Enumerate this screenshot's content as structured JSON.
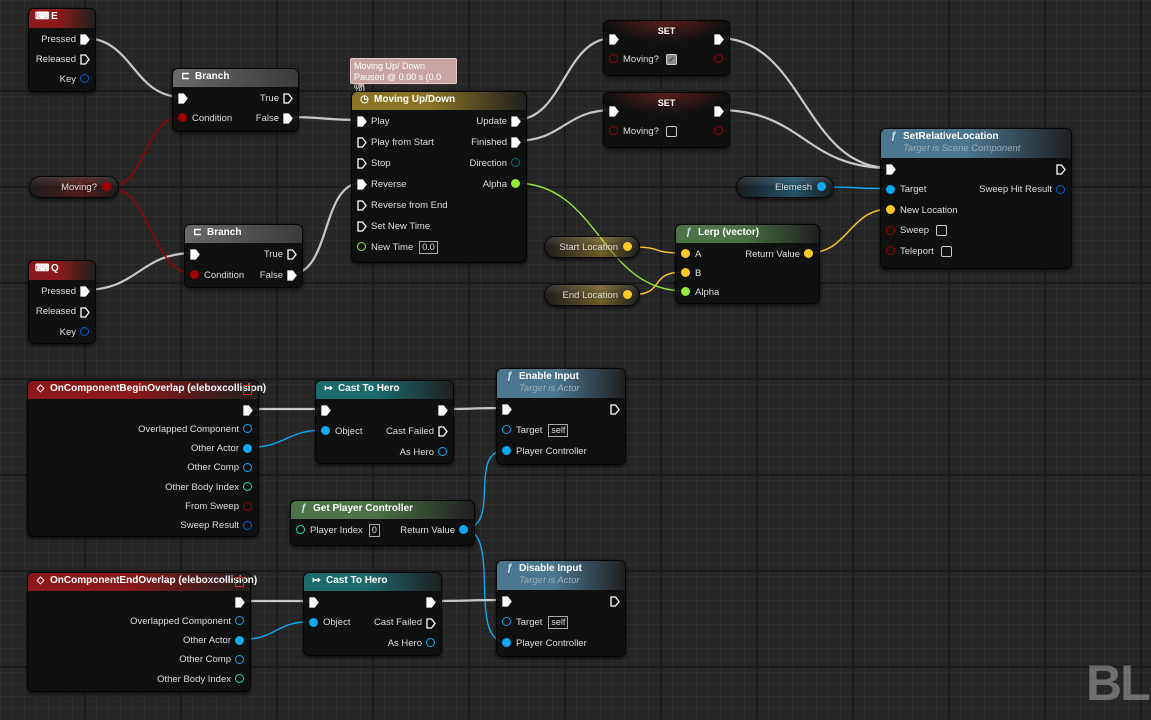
{
  "tooltip": {
    "line1": "Moving Up/ Down",
    "line2": "Paused @ 0.00 s (0.0 %)"
  },
  "watermark": "BL",
  "pin_colors": {
    "exec": "#ffffff",
    "bool": "#a00000",
    "object": "#10a8f0",
    "struct": "#0060d8",
    "vector": "#fdc82a",
    "float": "#96e83c",
    "int": "#22e0a8",
    "byte": "#007070"
  },
  "header_colors": {
    "input": "#8c1a1a",
    "branch": "#5c5c5c",
    "timeline": "#8a7424",
    "set": "#5a1c1c",
    "function": "#4a7690",
    "pure": "#4c7446",
    "cast": "#1c6a6c",
    "event": "#8a1818"
  },
  "graph": {
    "nodes": [
      {
        "id": "E",
        "kind": "input",
        "title": "E",
        "icon": "keyboard-icon",
        "inputs": [],
        "outputs": [
          {
            "type": "exec",
            "label": "Pressed",
            "linked": true
          },
          {
            "type": "exec",
            "label": "Released"
          },
          {
            "type": "struct",
            "label": "Key"
          }
        ]
      },
      {
        "id": "branch1",
        "kind": "branch",
        "title": "Branch",
        "icon": "branch-icon",
        "inputs": [
          {
            "type": "exec",
            "label": "",
            "linked": true
          },
          {
            "type": "bool",
            "label": "Condition",
            "linked": true
          }
        ],
        "outputs": [
          {
            "type": "exec",
            "label": "True"
          },
          {
            "type": "exec",
            "label": "False",
            "linked": true
          }
        ]
      },
      {
        "id": "moving",
        "kind": "variable",
        "title": "Moving?",
        "color": "bool",
        "outputs": [
          {
            "type": "bool",
            "linked": true
          }
        ]
      },
      {
        "id": "branch2",
        "kind": "branch",
        "title": "Branch",
        "icon": "branch-icon",
        "inputs": [
          {
            "type": "exec",
            "label": "",
            "linked": true
          },
          {
            "type": "bool",
            "label": "Condition",
            "linked": true
          }
        ],
        "outputs": [
          {
            "type": "exec",
            "label": "True"
          },
          {
            "type": "exec",
            "label": "False",
            "linked": true
          }
        ]
      },
      {
        "id": "Q",
        "kind": "input",
        "title": "Q",
        "icon": "keyboard-icon",
        "inputs": [],
        "outputs": [
          {
            "type": "exec",
            "label": "Pressed",
            "linked": true
          },
          {
            "type": "exec",
            "label": "Released"
          },
          {
            "type": "struct",
            "label": "Key"
          }
        ]
      },
      {
        "id": "timeline",
        "kind": "timeline",
        "title": "Moving Up/Down",
        "icon": "clock-icon",
        "inputs": [
          {
            "type": "exec",
            "label": "Play",
            "linked": true
          },
          {
            "type": "exec",
            "label": "Play from Start"
          },
          {
            "type": "exec",
            "label": "Stop"
          },
          {
            "type": "exec",
            "label": "Reverse",
            "linked": true
          },
          {
            "type": "exec",
            "label": "Reverse from End"
          },
          {
            "type": "exec",
            "label": "Set New Time"
          },
          {
            "type": "float",
            "label": "New Time",
            "value": "0.0"
          }
        ],
        "outputs": [
          {
            "type": "exec",
            "label": "Update",
            "linked": true
          },
          {
            "type": "exec",
            "label": "Finished",
            "linked": true
          },
          {
            "type": "byte",
            "label": "Direction"
          },
          {
            "type": "float",
            "label": "Alpha",
            "linked": true
          }
        ]
      },
      {
        "id": "set1",
        "kind": "set",
        "title": "SET",
        "inputs": [
          {
            "type": "exec",
            "label": "",
            "linked": true
          },
          {
            "type": "bool",
            "label": "Moving?",
            "checkbox": true
          }
        ],
        "outputs": [
          {
            "type": "exec",
            "label": "",
            "linked": true
          },
          {
            "type": "bool",
            "label": ""
          }
        ]
      },
      {
        "id": "set2",
        "kind": "set",
        "title": "SET",
        "inputs": [
          {
            "type": "exec",
            "label": "",
            "linked": true
          },
          {
            "type": "bool",
            "label": "Moving?",
            "checkbox": false
          }
        ],
        "outputs": [
          {
            "type": "exec",
            "label": "",
            "linked": true
          },
          {
            "type": "bool",
            "label": ""
          }
        ]
      },
      {
        "id": "setrel",
        "kind": "function",
        "title": "SetRelativeLocation",
        "subtitle": "Target is Scene Component",
        "icon": "function-icon",
        "inputs": [
          {
            "type": "exec",
            "label": "",
            "linked": true
          },
          {
            "type": "object",
            "label": "Target",
            "linked": true
          },
          {
            "type": "vector",
            "label": "New Location",
            "linked": true
          },
          {
            "type": "bool",
            "label": "Sweep",
            "checkbox": false
          },
          {
            "type": "bool",
            "label": "Teleport",
            "checkbox": false
          }
        ],
        "outputs": [
          {
            "type": "exec",
            "label": ""
          },
          {
            "type": "struct",
            "label": "Sweep Hit Result"
          }
        ]
      },
      {
        "id": "elemesh",
        "kind": "variable",
        "title": "Elemesh",
        "color": "object",
        "outputs": [
          {
            "type": "object",
            "linked": true
          }
        ]
      },
      {
        "id": "start",
        "kind": "variable",
        "title": "Start Location",
        "color": "vector",
        "outputs": [
          {
            "type": "vector",
            "linked": true
          }
        ]
      },
      {
        "id": "end",
        "kind": "variable",
        "title": "End Location",
        "color": "vector",
        "outputs": [
          {
            "type": "vector",
            "linked": true
          }
        ]
      },
      {
        "id": "lerp",
        "kind": "pure",
        "title": "Lerp (vector)",
        "icon": "function-icon",
        "inputs": [
          {
            "type": "vector",
            "label": "A",
            "linked": true
          },
          {
            "type": "vector",
            "label": "B",
            "linked": true
          },
          {
            "type": "float",
            "label": "Alpha",
            "linked": true
          }
        ],
        "outputs": [
          {
            "type": "vector",
            "label": "Return Value",
            "linked": true
          }
        ]
      },
      {
        "id": "begin",
        "kind": "event",
        "title": "OnComponentBeginOverlap (eleboxcollision)",
        "icon": "event-icon",
        "inputs": [],
        "outputs": [
          {
            "type": "exec",
            "label": "",
            "linked": true
          },
          {
            "type": "object",
            "label": "Overlapped Component"
          },
          {
            "type": "object",
            "label": "Other Actor",
            "linked": true
          },
          {
            "type": "object",
            "label": "Other Comp"
          },
          {
            "type": "int",
            "label": "Other Body Index"
          },
          {
            "type": "bool",
            "label": "From Sweep"
          },
          {
            "type": "struct",
            "label": "Sweep Result"
          }
        ]
      },
      {
        "id": "cast1",
        "kind": "cast",
        "title": "Cast To Hero",
        "icon": "cast-icon",
        "inputs": [
          {
            "type": "exec",
            "label": "",
            "linked": true
          },
          {
            "type": "object",
            "label": "Object",
            "linked": true
          }
        ],
        "outputs": [
          {
            "type": "exec",
            "label": "",
            "linked": true
          },
          {
            "type": "exec",
            "label": "Cast Failed"
          },
          {
            "type": "object",
            "label": "As Hero"
          }
        ]
      },
      {
        "id": "enable",
        "kind": "function",
        "title": "Enable Input",
        "subtitle": "Target is Actor",
        "icon": "function-icon",
        "inputs": [
          {
            "type": "exec",
            "label": "",
            "linked": true
          },
          {
            "type": "object",
            "label": "Target",
            "value": "self"
          },
          {
            "type": "object",
            "label": "Player Controller",
            "linked": true
          }
        ],
        "outputs": [
          {
            "type": "exec",
            "label": ""
          }
        ]
      },
      {
        "id": "gpc",
        "kind": "pure",
        "title": "Get Player Controller",
        "icon": "function-icon",
        "inputs": [
          {
            "type": "int",
            "label": "Player Index",
            "value": "0"
          }
        ],
        "outputs": [
          {
            "type": "object",
            "label": "Return Value",
            "linked": true
          }
        ]
      },
      {
        "id": "endov",
        "kind": "event",
        "title": "OnComponentEndOverlap (eleboxcollision)",
        "icon": "event-icon",
        "inputs": [],
        "outputs": [
          {
            "type": "exec",
            "label": "",
            "linked": true
          },
          {
            "type": "object",
            "label": "Overlapped Component"
          },
          {
            "type": "object",
            "label": "Other Actor",
            "linked": true
          },
          {
            "type": "object",
            "label": "Other Comp"
          },
          {
            "type": "int",
            "label": "Other Body Index"
          }
        ]
      },
      {
        "id": "cast2",
        "kind": "cast",
        "title": "Cast To Hero",
        "icon": "cast-icon",
        "inputs": [
          {
            "type": "exec",
            "label": "",
            "linked": true
          },
          {
            "type": "object",
            "label": "Object",
            "linked": true
          }
        ],
        "outputs": [
          {
            "type": "exec",
            "label": "",
            "linked": true
          },
          {
            "type": "exec",
            "label": "Cast Failed"
          },
          {
            "type": "object",
            "label": "As Hero"
          }
        ]
      },
      {
        "id": "disable",
        "kind": "function",
        "title": "Disable Input",
        "subtitle": "Target is Actor",
        "icon": "function-icon",
        "inputs": [
          {
            "type": "exec",
            "label": "",
            "linked": true
          },
          {
            "type": "object",
            "label": "Target",
            "value": "self"
          },
          {
            "type": "object",
            "label": "Player Controller",
            "linked": true
          }
        ],
        "outputs": [
          {
            "type": "exec",
            "label": ""
          }
        ]
      }
    ],
    "wires": [
      [
        "E",
        0,
        "branch1",
        0
      ],
      [
        "Q",
        0,
        "branch2",
        0
      ],
      [
        "moving",
        0,
        "branch1",
        1
      ],
      [
        "moving",
        0,
        "branch2",
        1
      ],
      [
        "branch1",
        1,
        "timeline",
        0
      ],
      [
        "branch2",
        1,
        "timeline",
        3
      ],
      [
        "timeline",
        0,
        "set1",
        0
      ],
      [
        "timeline",
        1,
        "set2",
        0
      ],
      [
        "set1",
        0,
        "setrel",
        0
      ],
      [
        "set2",
        0,
        "setrel",
        0
      ],
      [
        "elemesh",
        0,
        "setrel",
        1
      ],
      [
        "timeline",
        3,
        "lerp",
        2
      ],
      [
        "start",
        0,
        "lerp",
        0
      ],
      [
        "end",
        0,
        "lerp",
        1
      ],
      [
        "lerp",
        0,
        "setrel",
        2
      ],
      [
        "begin",
        0,
        "cast1",
        0
      ],
      [
        "begin",
        2,
        "cast1",
        1
      ],
      [
        "cast1",
        0,
        "enable",
        0
      ],
      [
        "gpc",
        0,
        "enable",
        2
      ],
      [
        "gpc",
        0,
        "disable",
        2
      ],
      [
        "endov",
        0,
        "cast2",
        0
      ],
      [
        "endov",
        2,
        "cast2",
        1
      ],
      [
        "cast2",
        0,
        "disable",
        0
      ]
    ]
  }
}
